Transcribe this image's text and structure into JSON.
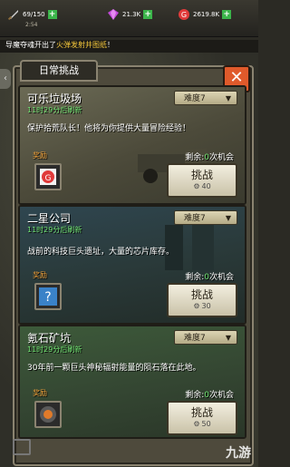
{
  "topbar": {
    "stamina": "69/150",
    "stamina_timer": "2:54",
    "gems": "21.3K",
    "coins": "2619.8K"
  },
  "ticker": {
    "prefix": "导魔夺魂开出了",
    "highlight": "火弹发射井图纸",
    "suffix": "！"
  },
  "panel": {
    "tab_label": "日常挑战",
    "close_glyph": "✕"
  },
  "cards": [
    {
      "title": "可乐垃圾场",
      "refresh": "11时29分后刷新",
      "difficulty": "难度7",
      "description": "保护拾荒队长！他将为你提供大量冒险经验！",
      "reward_label": "奖励",
      "remaining_prefix": "剩余:",
      "remaining_count": "0",
      "remaining_suffix": "次机会",
      "button_label": "挑战",
      "button_cost": "40",
      "reward_icon": "g-coin-icon"
    },
    {
      "title": "二星公司",
      "refresh": "11时29分后刷新",
      "difficulty": "难度7",
      "description": "战前的科技巨头遗址，大量的芯片库存。",
      "reward_label": "奖励",
      "remaining_prefix": "剩余:",
      "remaining_count": "0",
      "remaining_suffix": "次机会",
      "button_label": "挑战",
      "button_cost": "30",
      "reward_icon": "mystery-chip-icon"
    },
    {
      "title": "氪石矿坑",
      "refresh": "11时29分后刷新",
      "difficulty": "难度7",
      "description": "30年前一颗巨头神秘辐射能量的陨石落在此地。",
      "reward_label": "奖励",
      "remaining_prefix": "剩余:",
      "remaining_count": "0",
      "remaining_suffix": "次机会",
      "button_label": "挑战",
      "button_cost": "50",
      "reward_icon": "kryptonite-icon"
    }
  ],
  "watermark": "九游"
}
